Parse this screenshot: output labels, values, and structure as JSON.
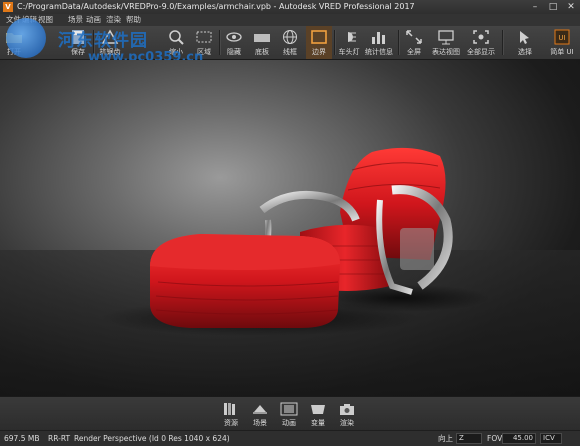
{
  "window": {
    "title": "C:/ProgramData/Autodesk/VREDPro-9.0/Examples/armchair.vpb - Autodesk VRED Professional 2017",
    "app_icon": "V",
    "controls": [
      "–",
      "□",
      "✕"
    ]
  },
  "menu": [
    "文件",
    "编辑",
    "视图",
    "场景",
    "动画",
    "渲染",
    "帮助"
  ],
  "watermark": {
    "line1": "河东软件园",
    "line2": "www.pc0359.cn"
  },
  "toolbar": {
    "items": [
      {
        "id": "open",
        "label": "打开",
        "icon": "folder-icon"
      },
      {
        "id": "save",
        "label": "保存",
        "icon": "save-icon"
      },
      {
        "id": "antialias",
        "label": "抗锯齿",
        "icon": "antialias-icon"
      },
      {
        "id": "shrink",
        "label": "缩小",
        "icon": "zoom-out-icon"
      },
      {
        "id": "region",
        "label": "区域",
        "icon": "region-icon"
      },
      {
        "id": "hide",
        "label": "隐藏",
        "icon": "eye-icon"
      },
      {
        "id": "floor",
        "label": "底板",
        "icon": "floor-icon"
      },
      {
        "id": "wireframe",
        "label": "线框",
        "icon": "wireframe-icon"
      },
      {
        "id": "boundary",
        "label": "边界",
        "icon": "boundary-icon"
      },
      {
        "id": "headlight",
        "label": "车头灯",
        "icon": "headlight-icon"
      },
      {
        "id": "stats",
        "label": "统计信息",
        "icon": "stats-icon"
      },
      {
        "id": "fullscreen",
        "label": "全屏",
        "icon": "fullscreen-icon"
      },
      {
        "id": "renderview",
        "label": "表达视图",
        "icon": "render-view-icon"
      },
      {
        "id": "showall",
        "label": "全部显示",
        "icon": "show-all-icon"
      },
      {
        "id": "select",
        "label": "选择",
        "icon": "select-icon"
      },
      {
        "id": "simpleui",
        "label": "简单 UI",
        "icon": "ui-icon"
      }
    ]
  },
  "dock": {
    "items": [
      {
        "id": "assets",
        "label": "资源",
        "icon": "books-icon"
      },
      {
        "id": "scene",
        "label": "场景",
        "icon": "scene-icon"
      },
      {
        "id": "animation",
        "label": "动画",
        "icon": "film-icon"
      },
      {
        "id": "variants",
        "label": "变量",
        "icon": "variants-icon"
      },
      {
        "id": "render",
        "label": "渲染",
        "icon": "camera-icon"
      }
    ]
  },
  "status": {
    "memory": "697.5 MB",
    "mode": "RR-RT",
    "render_info": "Render Perspective (Id 0 Res 1040 x 624)",
    "up_label": "向上",
    "up_value": "Z",
    "fov_label": "FOV",
    "fov_value": "45.00",
    "icv_label": "ICV"
  },
  "colors": {
    "accent": "#e07818",
    "chair_red": "#d0161c",
    "watermark": "#1e6fc4"
  }
}
